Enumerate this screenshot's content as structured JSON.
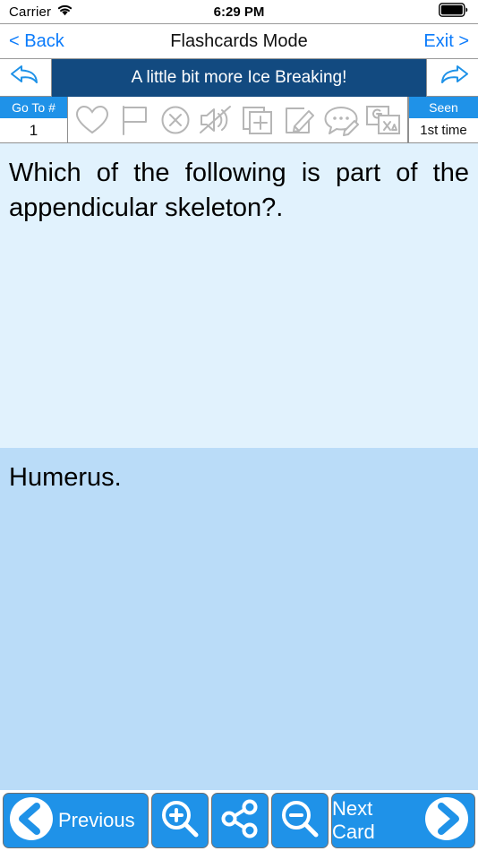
{
  "statusbar": {
    "carrier": "Carrier",
    "wifi_icon": "wifi-icon",
    "time": "6:29 PM",
    "battery_icon": "battery-full-icon"
  },
  "navbar": {
    "back_label": "< Back",
    "title": "Flashcards Mode",
    "exit_label": "Exit >"
  },
  "banner": {
    "undo_icon": "undo-arrow-icon",
    "title": "A little bit more Ice Breaking!",
    "redo_icon": "redo-arrow-icon"
  },
  "toolbar": {
    "goto_label": "Go To #",
    "goto_value": "1",
    "icons": [
      {
        "name": "heart-icon",
        "label": "Favorite"
      },
      {
        "name": "flag-icon",
        "label": "Flag"
      },
      {
        "name": "close-circle-icon",
        "label": "Mark Wrong"
      },
      {
        "name": "speaker-mute-icon",
        "label": "Mute Audio"
      },
      {
        "name": "add-card-icon",
        "label": "Add Card"
      },
      {
        "name": "edit-pencil-icon",
        "label": "Edit"
      },
      {
        "name": "comment-pencil-icon",
        "label": "Note"
      },
      {
        "name": "google-translate-icon",
        "label": "Translate"
      }
    ],
    "seen_label": "Seen",
    "seen_value": "1st time"
  },
  "card": {
    "question": "Which of the following is part of the appendicular skeleton?.",
    "answer": "Humerus."
  },
  "bottombar": {
    "previous_label": "Previous",
    "previous_icon": "chevron-left-circle-icon",
    "zoom_in_icon": "zoom-in-icon",
    "share_icon": "share-icon",
    "zoom_out_icon": "zoom-out-icon",
    "next_label": "Next Card",
    "next_icon": "chevron-right-circle-icon"
  },
  "colors": {
    "accent_blue": "#1f92e8",
    "link_blue": "#0b7bfb",
    "banner_navy": "#124a80",
    "question_bg": "#e1f2fd",
    "answer_bg": "#badcf8",
    "icon_gray": "#b6b6b6"
  }
}
